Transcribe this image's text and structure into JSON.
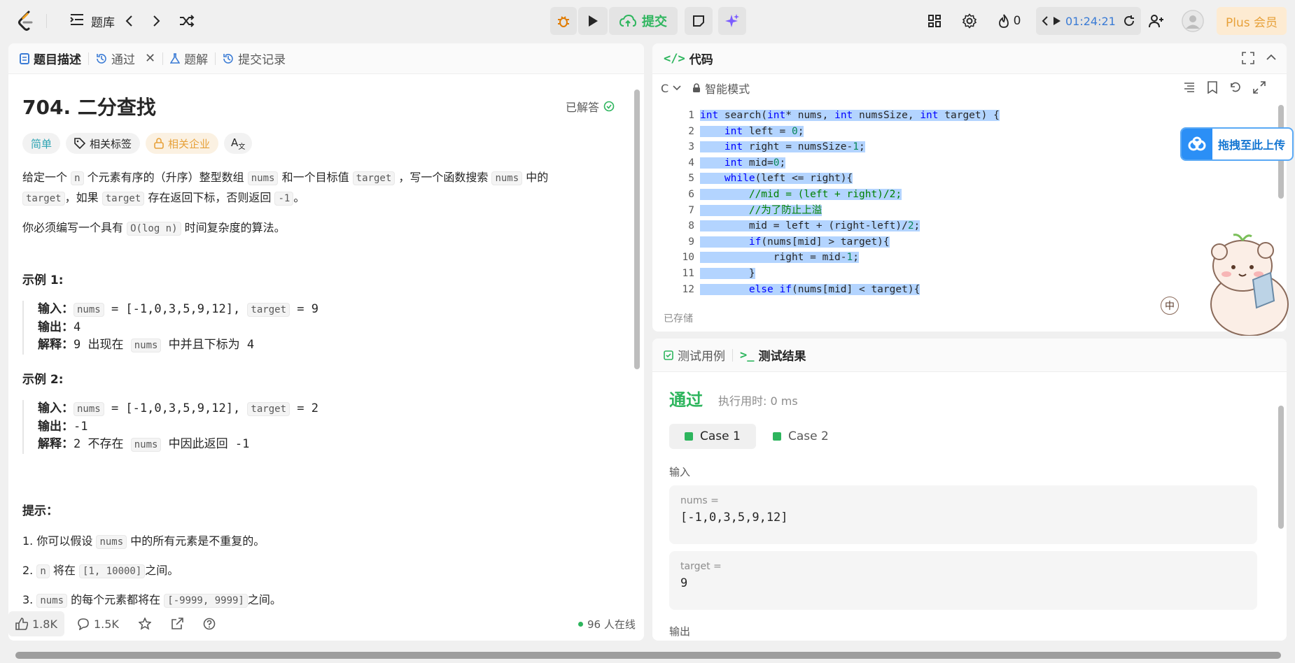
{
  "topbar": {
    "problem_list_label": "题库",
    "submit_label": "提交",
    "fire_count": "0",
    "timer": "01:24:21",
    "plus_label": "Plus 会员"
  },
  "left_panel": {
    "tabs": [
      {
        "label": "题目描述"
      },
      {
        "label": "通过"
      },
      {
        "label": "题解"
      },
      {
        "label": "提交记录"
      }
    ],
    "title": "704. 二分查找",
    "solved_label": "已解答",
    "tags": [
      "简单",
      "相关标签",
      "相关企业"
    ],
    "description": {
      "p1_a": "给定一个",
      "p1_code1": "n",
      "p1_b": "个元素有序的（升序）整型数组",
      "p1_code2": "nums",
      "p1_c": "和一个目标值",
      "p1_code3": "target",
      "p1_d": "，写一个函数搜索",
      "p1_code4": "nums",
      "p1_e": "中的",
      "p1_code5": "target",
      "p1_f": "，如果",
      "p1_code6": "target",
      "p1_g": "存在返回下标，否则返回",
      "p1_code7": "-1",
      "p1_h": "。",
      "p2_a": "你必须编写一个具有",
      "p2_code": "O(log n)",
      "p2_b": "时间复杂度的算法。"
    },
    "example1": {
      "heading": "示例 1:",
      "input_label": "输入：",
      "input_code1": "nums",
      "input_mid": " = [-1,0,3,5,9,12], ",
      "input_code2": "target",
      "input_end": " = 9",
      "output_label": "输出：",
      "output": "4",
      "explain_label": "解释：",
      "explain_a": "9 出现在 ",
      "explain_code": "nums",
      "explain_b": " 中并且下标为 4"
    },
    "example2": {
      "heading": "示例 2:",
      "input_label": "输入：",
      "input_code1": "nums",
      "input_mid": " = [-1,0,3,5,9,12], ",
      "input_code2": "target",
      "input_end": " = 2",
      "output_label": "输出：",
      "output": "-1",
      "explain_label": "解释：",
      "explain_a": "2 不存在 ",
      "explain_code": "nums",
      "explain_b": " 中因此返回 -1"
    },
    "hints": {
      "heading": "提示：",
      "h1_a": "1. 你可以假设",
      "h1_code": "nums",
      "h1_b": "中的所有元素是不重复的。",
      "h2_a": "2.",
      "h2_code1": "n",
      "h2_b": "将在",
      "h2_code2": "[1, 10000]",
      "h2_c": "之间。",
      "h3_a": "3.",
      "h3_code1": "nums",
      "h3_b": "的每个元素都将在",
      "h3_code2": "[-9999, 9999]",
      "h3_c": "之间。"
    },
    "bottom": {
      "likes": "1.8K",
      "comments": "1.5K",
      "online": "96 人在线"
    }
  },
  "code_panel": {
    "title": "代码",
    "language": "C",
    "mode": "智能模式",
    "saved": "已存储",
    "upload_label": "拖拽至此上传",
    "lines": [
      {
        "n": "1",
        "indent": "",
        "code": "int search(int* nums, int numsSize, int target) {"
      },
      {
        "n": "2",
        "indent": "    ",
        "code": "int left = 0;"
      },
      {
        "n": "3",
        "indent": "    ",
        "code": "int right = numsSize-1;"
      },
      {
        "n": "4",
        "indent": "    ",
        "code": "int mid=0;"
      },
      {
        "n": "5",
        "indent": "    ",
        "code": "while(left <= right){"
      },
      {
        "n": "6",
        "indent": "        ",
        "code": "//mid = (left + right)/2;"
      },
      {
        "n": "7",
        "indent": "        ",
        "code": "//为了防止上溢"
      },
      {
        "n": "8",
        "indent": "        ",
        "code": "mid = left + (right-left)/2;"
      },
      {
        "n": "9",
        "indent": "        ",
        "code": "if(nums[mid] > target){"
      },
      {
        "n": "10",
        "indent": "            ",
        "code": "right = mid-1;"
      },
      {
        "n": "11",
        "indent": "        ",
        "code": "}"
      },
      {
        "n": "12",
        "indent": "        ",
        "code": "else if(nums[mid] < target){"
      }
    ]
  },
  "test_panel": {
    "tabs": [
      "测试用例",
      "测试结果"
    ],
    "result": "通过",
    "exec_time": "执行用时: 0 ms",
    "cases": [
      "Case 1",
      "Case 2"
    ],
    "input_label": "输入",
    "input1_name": "nums =",
    "input1_value": "[-1,0,3,5,9,12]",
    "input2_name": "target =",
    "input2_value": "9",
    "output_label": "输出"
  },
  "colors": {
    "accent_green": "#2db55d",
    "accent_blue": "#3a7bd5",
    "plus_orange": "#e7a13a"
  }
}
